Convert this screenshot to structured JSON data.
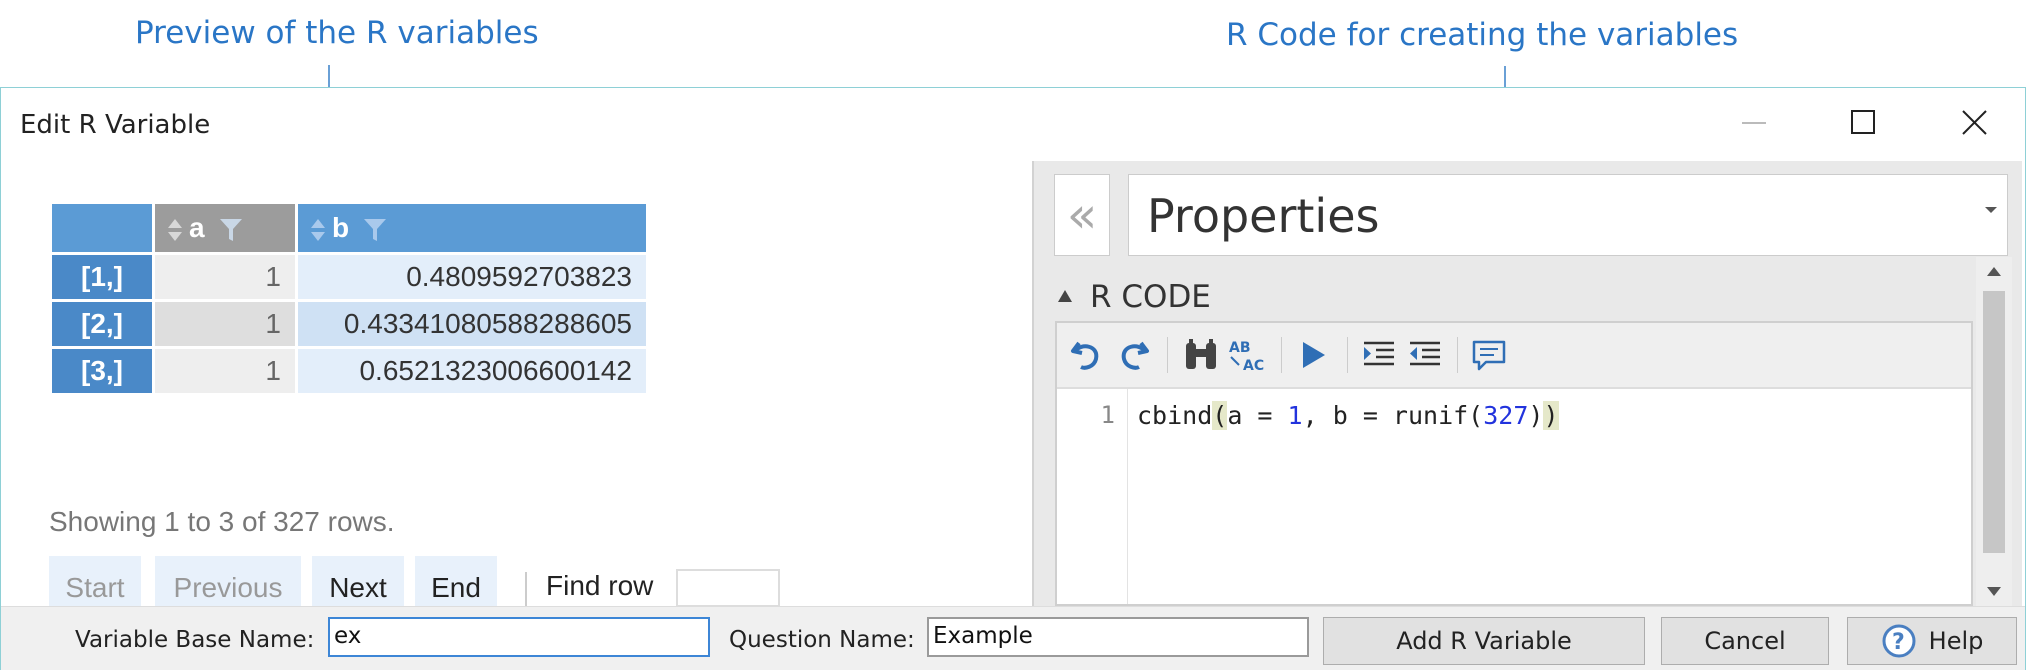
{
  "annotations": {
    "left": "Preview of the R variables",
    "right": "R Code for creating the variables"
  },
  "window": {
    "title": "Edit R Variable",
    "controls": [
      "minimize-icon",
      "maximize-icon",
      "close-icon"
    ]
  },
  "preview": {
    "columns": [
      "a",
      "b"
    ],
    "rows": [
      {
        "label": "[1,]",
        "a": "1",
        "b": "0.4809592703823"
      },
      {
        "label": "[2,]",
        "a": "1",
        "b": "0.43341080588288605"
      },
      {
        "label": "[3,]",
        "a": "1",
        "b": "0.6521323006600142"
      }
    ],
    "status": "Showing 1 to 3 of 327 rows.",
    "pager": {
      "start": "Start",
      "previous": "Previous",
      "next": "Next",
      "end": "End",
      "find_row_label": "Find row",
      "find_row_value": ""
    }
  },
  "properties": {
    "collapse_glyph": "«",
    "title": "Properties",
    "section": "R CODE",
    "toolbar_icons": [
      "undo-icon",
      "redo-icon",
      "find-icon",
      "spellcheck-icon",
      "run-icon",
      "indent-icon",
      "outdent-icon",
      "comment-icon"
    ],
    "code": {
      "line_number": "1",
      "fn": "cbind",
      "open": "(",
      "mid": "a = ",
      "num1": "1",
      "mid2": ", b = runif(",
      "num2": "327",
      "close_inner": ")",
      "close": ")"
    }
  },
  "bottom": {
    "base_name_label": "Variable Base Name:",
    "base_name_value": "ex",
    "question_name_label": "Question Name:",
    "question_name_value": "Example",
    "add_button": "Add R Variable",
    "cancel_button": "Cancel",
    "help_button": "Help"
  },
  "colors": {
    "accent": "#5b9bd5",
    "annotation": "#2a76c6",
    "window_border": "#8ed0d6"
  }
}
